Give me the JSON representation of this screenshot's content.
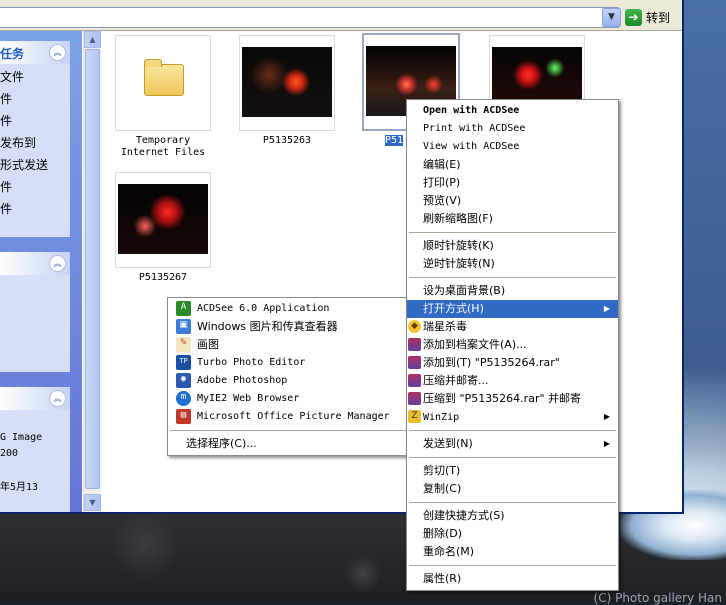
{
  "address_bar": {
    "goto_label": "转到"
  },
  "task_pane": {
    "panel1": {
      "title": "任务",
      "items": [
        "文件",
        "件",
        "件",
        "发布到",
        "形式发送",
        "件",
        "件"
      ]
    },
    "details": {
      "lines": [
        "G Image",
        "200",
        "年5月13"
      ]
    }
  },
  "files": [
    {
      "label": "Temporary Internet Files",
      "icon": "folder-icon"
    },
    {
      "label": "P5135263",
      "icon": "photo-thumbnail"
    },
    {
      "label": "P51",
      "icon": "photo-thumbnail"
    },
    {
      "label": "",
      "icon": "photo-thumbnail"
    },
    {
      "label": "P5135267",
      "icon": "photo-thumbnail"
    }
  ],
  "context_menu": {
    "items": [
      "Open with ACDSee",
      "Print with ACDSee",
      "View with ACDSee",
      "编辑(E)",
      "打印(P)",
      "预览(V)",
      "刷新缩略图(F)",
      "顺时针旋转(K)",
      "逆时针旋转(N)",
      "设为桌面背景(B)",
      "打开方式(H)",
      "瑞星杀毒",
      "添加到档案文件(A)...",
      "添加到(T) \"P5135264.rar\"",
      "压缩并邮寄...",
      "压缩到 \"P5135264.rar\" 并邮寄",
      "WinZip",
      "发送到(N)",
      "剪切(T)",
      "复制(C)",
      "创建快捷方式(S)",
      "删除(D)",
      "重命名(M)",
      "属性(R)"
    ]
  },
  "open_with_menu": {
    "items": [
      "ACDSee 6.0 Application",
      "Windows 图片和传真查看器",
      "画图",
      "Turbo Photo Editor",
      "Adobe Photoshop",
      "MyIE2 Web Browser",
      "Microsoft Office Picture Manager",
      "选择程序(C)..."
    ]
  },
  "desktop": {
    "credit": "(C) Photo gallery Han"
  },
  "colors": {
    "highlight": "#316ac5",
    "taskpane_title": "#215dc6"
  }
}
